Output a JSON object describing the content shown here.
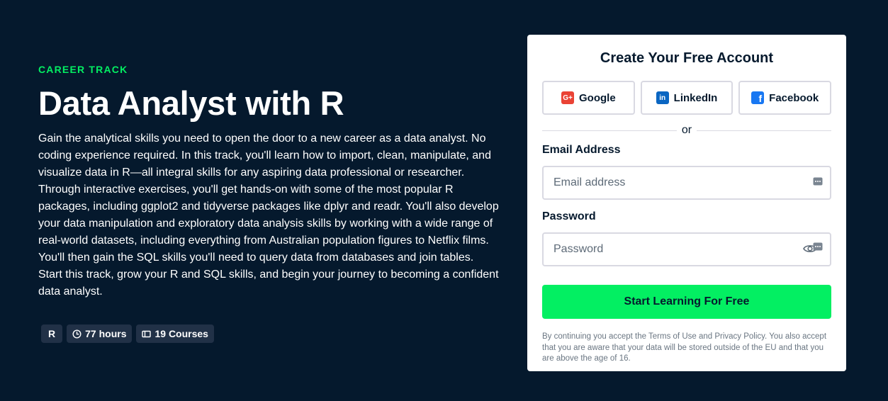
{
  "hero": {
    "eyebrow": "CAREER TRACK",
    "title": "Data Analyst with R",
    "description": "Gain the analytical skills you need to open the door to a new career as a data analyst. No coding experience required. In this track, you'll learn how to import, clean, manipulate, and visualize data in R—all integral skills for any aspiring data professional or researcher. Through interactive exercises, you'll get hands-on with some of the most popular R packages, including ggplot2 and tidyverse packages like dplyr and readr. You'll also develop your data manipulation and exploratory data analysis skills by working with a wide range of real-world datasets, including everything from Australian population figures to Netflix films. You'll then gain the SQL skills you'll need to query data from databases and join tables. Start this track, grow your R and SQL skills, and begin your journey to becoming a confident data analyst."
  },
  "chips": {
    "technology": "R",
    "duration": "77 hours",
    "courses": "19 Courses",
    "duration_icon": "clock-icon",
    "courses_icon": "courses-icon"
  },
  "signup": {
    "title": "Create Your Free Account",
    "social": {
      "google": "Google",
      "linkedin": "LinkedIn",
      "facebook": "Facebook"
    },
    "divider": "or",
    "email_label": "Email Address",
    "email_placeholder": "Email address",
    "password_label": "Password",
    "password_placeholder": "Password",
    "cta": "Start Learning For Free",
    "legal": "By continuing you accept the Terms of Use and Privacy Policy. You also accept that you are aware that your data will be stored outside of the EU and that you are above the age of 16."
  },
  "colors": {
    "background": "#05192d",
    "accent": "#03ef62",
    "chip_bg": "#213147",
    "google": "#ea4335",
    "linkedin": "#0a66c2",
    "facebook": "#1877f2"
  }
}
